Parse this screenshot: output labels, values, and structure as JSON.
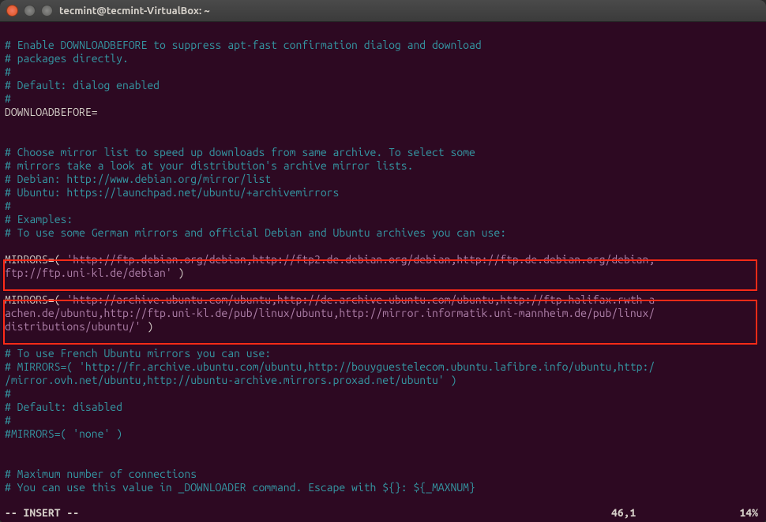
{
  "window": {
    "title": "tecmint@tecmint-VirtualBox: ~"
  },
  "lines": {
    "l1": "# Enable DOWNLOADBEFORE to suppress apt-fast confirmation dialog and download",
    "l2": "# packages directly.",
    "l3": "#",
    "l4": "# Default: dialog enabled",
    "l5": "#",
    "l6": "DOWNLOADBEFORE=",
    "l7": "",
    "l8": "",
    "l9": "# Choose mirror list to speed up downloads from same archive. To select some",
    "l10": "# mirrors take a look at your distribution's archive mirror lists.",
    "l11": "# Debian: http://www.debian.org/mirror/list",
    "l12": "# Ubuntu: https://launchpad.net/ubuntu/+archivemirrors",
    "l13": "#",
    "l14": "# Examples:",
    "l15": "# To use some German mirrors and official Debian and Ubuntu archives you can use:",
    "l16": "",
    "m1a": "MIRRORS=( ",
    "m1b": "'http://ftp.debian.org/debian,http://ftp2.de.debian.org/debian,http://ftp.de.debian.org/debian,",
    "m1c": "ftp://ftp.uni-kl.de/debian'",
    "m1d": " )",
    "l17": "",
    "m2a": "MIRRORS=( ",
    "m2b": "'http://archive.ubuntu.com/ubuntu,http://de.archive.ubuntu.com/ubuntu,http://ftp.halifax.rwth-a",
    "m2c": "achen.de/ubuntu,http://ftp.uni-kl.de/pub/linux/ubuntu,http://mirror.informatik.uni-mannheim.de/pub/linux/",
    "m2d": "distributions/ubuntu/'",
    "m2e": " )",
    "l18": "",
    "l19": "# To use French Ubuntu mirrors you can use:",
    "l20": "# MIRRORS=( 'http://fr.archive.ubuntu.com/ubuntu,http://bouyguestelecom.ubuntu.lafibre.info/ubuntu,http:/",
    "l21": "/mirror.ovh.net/ubuntu,http://ubuntu-archive.mirrors.proxad.net/ubuntu' )",
    "l22": "#",
    "l23": "# Default: disabled",
    "l24": "#",
    "l25": "#MIRRORS=( 'none' )",
    "l26": "",
    "l27": "",
    "l28": "# Maximum number of connections",
    "l29": "# You can use this value in _DOWNLOADER command. Escape with ${}: ${_MAXNUM}"
  },
  "status": {
    "mode": "-- INSERT --",
    "position": "46,1",
    "percent": "14%"
  }
}
